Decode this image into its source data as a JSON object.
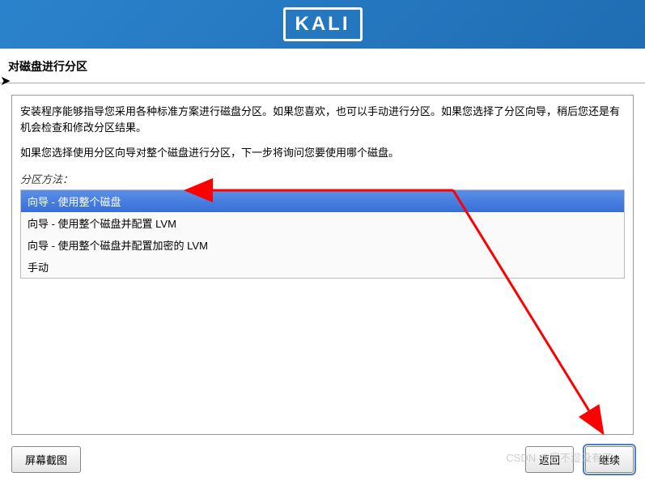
{
  "header": {
    "logo": "KALI"
  },
  "title": "对磁盘进行分区",
  "description1": "安装程序能够指导您采用各种标准方案进行磁盘分区。如果您喜欢，也可以手动进行分区。如果您选择了分区向导，稍后您还是有机会检查和修改分区结果。",
  "description2": "如果您选择使用分区向导对整个磁盘进行分区，下一步将询问您要使用哪个磁盘。",
  "method_label": "分区方法：",
  "options": [
    {
      "label": "向导 - 使用整个磁盘",
      "selected": true
    },
    {
      "label": "向导 - 使用整个磁盘并配置 LVM",
      "selected": false
    },
    {
      "label": "向导 - 使用整个磁盘并配置加密的 LVM",
      "selected": false
    },
    {
      "label": "手动",
      "selected": false
    }
  ],
  "buttons": {
    "screenshot": "屏幕截图",
    "back": "返回",
    "continue": "继续"
  },
  "watermark": "CSDN @尿不湿没有了"
}
